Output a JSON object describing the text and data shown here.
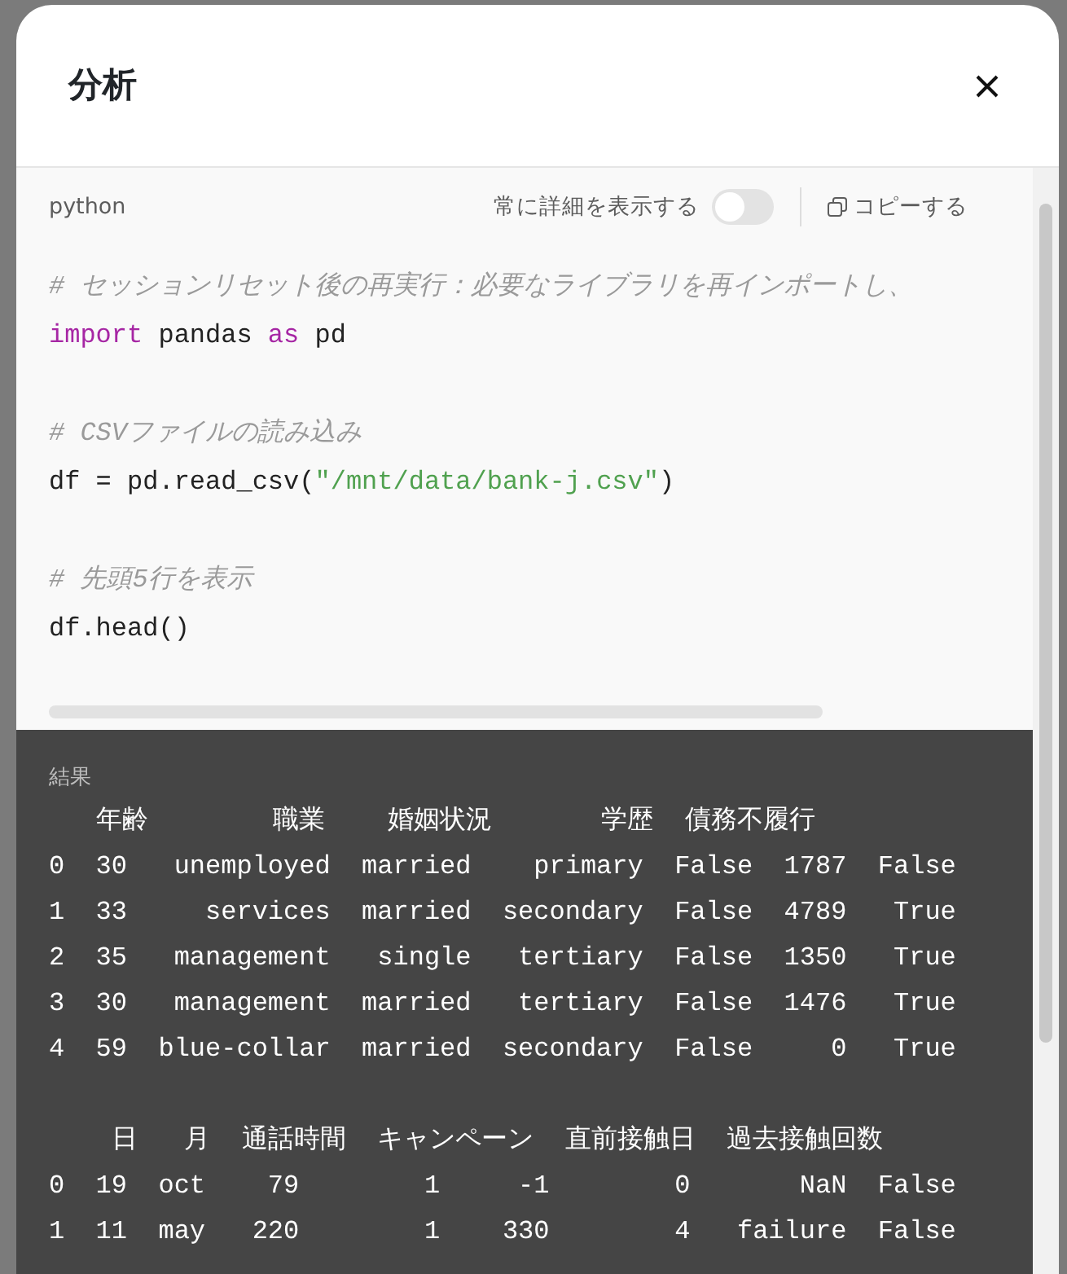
{
  "dialog": {
    "title": "分析",
    "code_panel": {
      "language": "python",
      "details_toggle": {
        "label": "常に詳細を表示する",
        "on": false
      },
      "copy_label": "コピーする",
      "lines": [
        {
          "kind": "code",
          "tokens": [
            {
              "kind": "comment",
              "text": "# セッションリセット後の再実行：必要なライブラリを再インポートし、"
            }
          ]
        },
        {
          "kind": "code",
          "tokens": [
            {
              "kind": "keyword",
              "text": "import"
            },
            {
              "kind": "plain",
              "text": " pandas "
            },
            {
              "kind": "keyword",
              "text": "as"
            },
            {
              "kind": "plain",
              "text": " pd"
            }
          ]
        },
        {
          "kind": "blank"
        },
        {
          "kind": "code",
          "tokens": [
            {
              "kind": "comment",
              "text": "# CSVファイルの読み込み"
            }
          ]
        },
        {
          "kind": "code",
          "tokens": [
            {
              "kind": "plain",
              "text": "df = pd.read_csv("
            },
            {
              "kind": "string",
              "text": "\"/mnt/data/bank-j.csv\""
            },
            {
              "kind": "plain",
              "text": ")"
            }
          ]
        },
        {
          "kind": "blank"
        },
        {
          "kind": "code",
          "tokens": [
            {
              "kind": "comment",
              "text": "# 先頭5行を表示"
            }
          ]
        },
        {
          "kind": "code",
          "tokens": [
            {
              "kind": "plain",
              "text": "df.head()"
            }
          ]
        }
      ]
    },
    "output": {
      "label": "結果",
      "blocks": [
        {
          "lines": [
            "   年齢        職業    婚姻状況       学歴  債務不履行",
            "0  30   unemployed  married    primary  False  1787  False",
            "1  33     services  married  secondary  False  4789   True",
            "2  35   management   single   tertiary  False  1350   True",
            "3  30   management  married   tertiary  False  1476   True",
            "4  59  blue-collar  married  secondary  False     0   True"
          ]
        },
        {
          "lines": [
            "    日   月  通話時間  キャンペーン  直前接触日  過去接触回数",
            "0  19  oct    79        1     -1        0       NaN  False",
            "1  11  may   220        1    330        4   failure  False"
          ]
        }
      ]
    }
  }
}
